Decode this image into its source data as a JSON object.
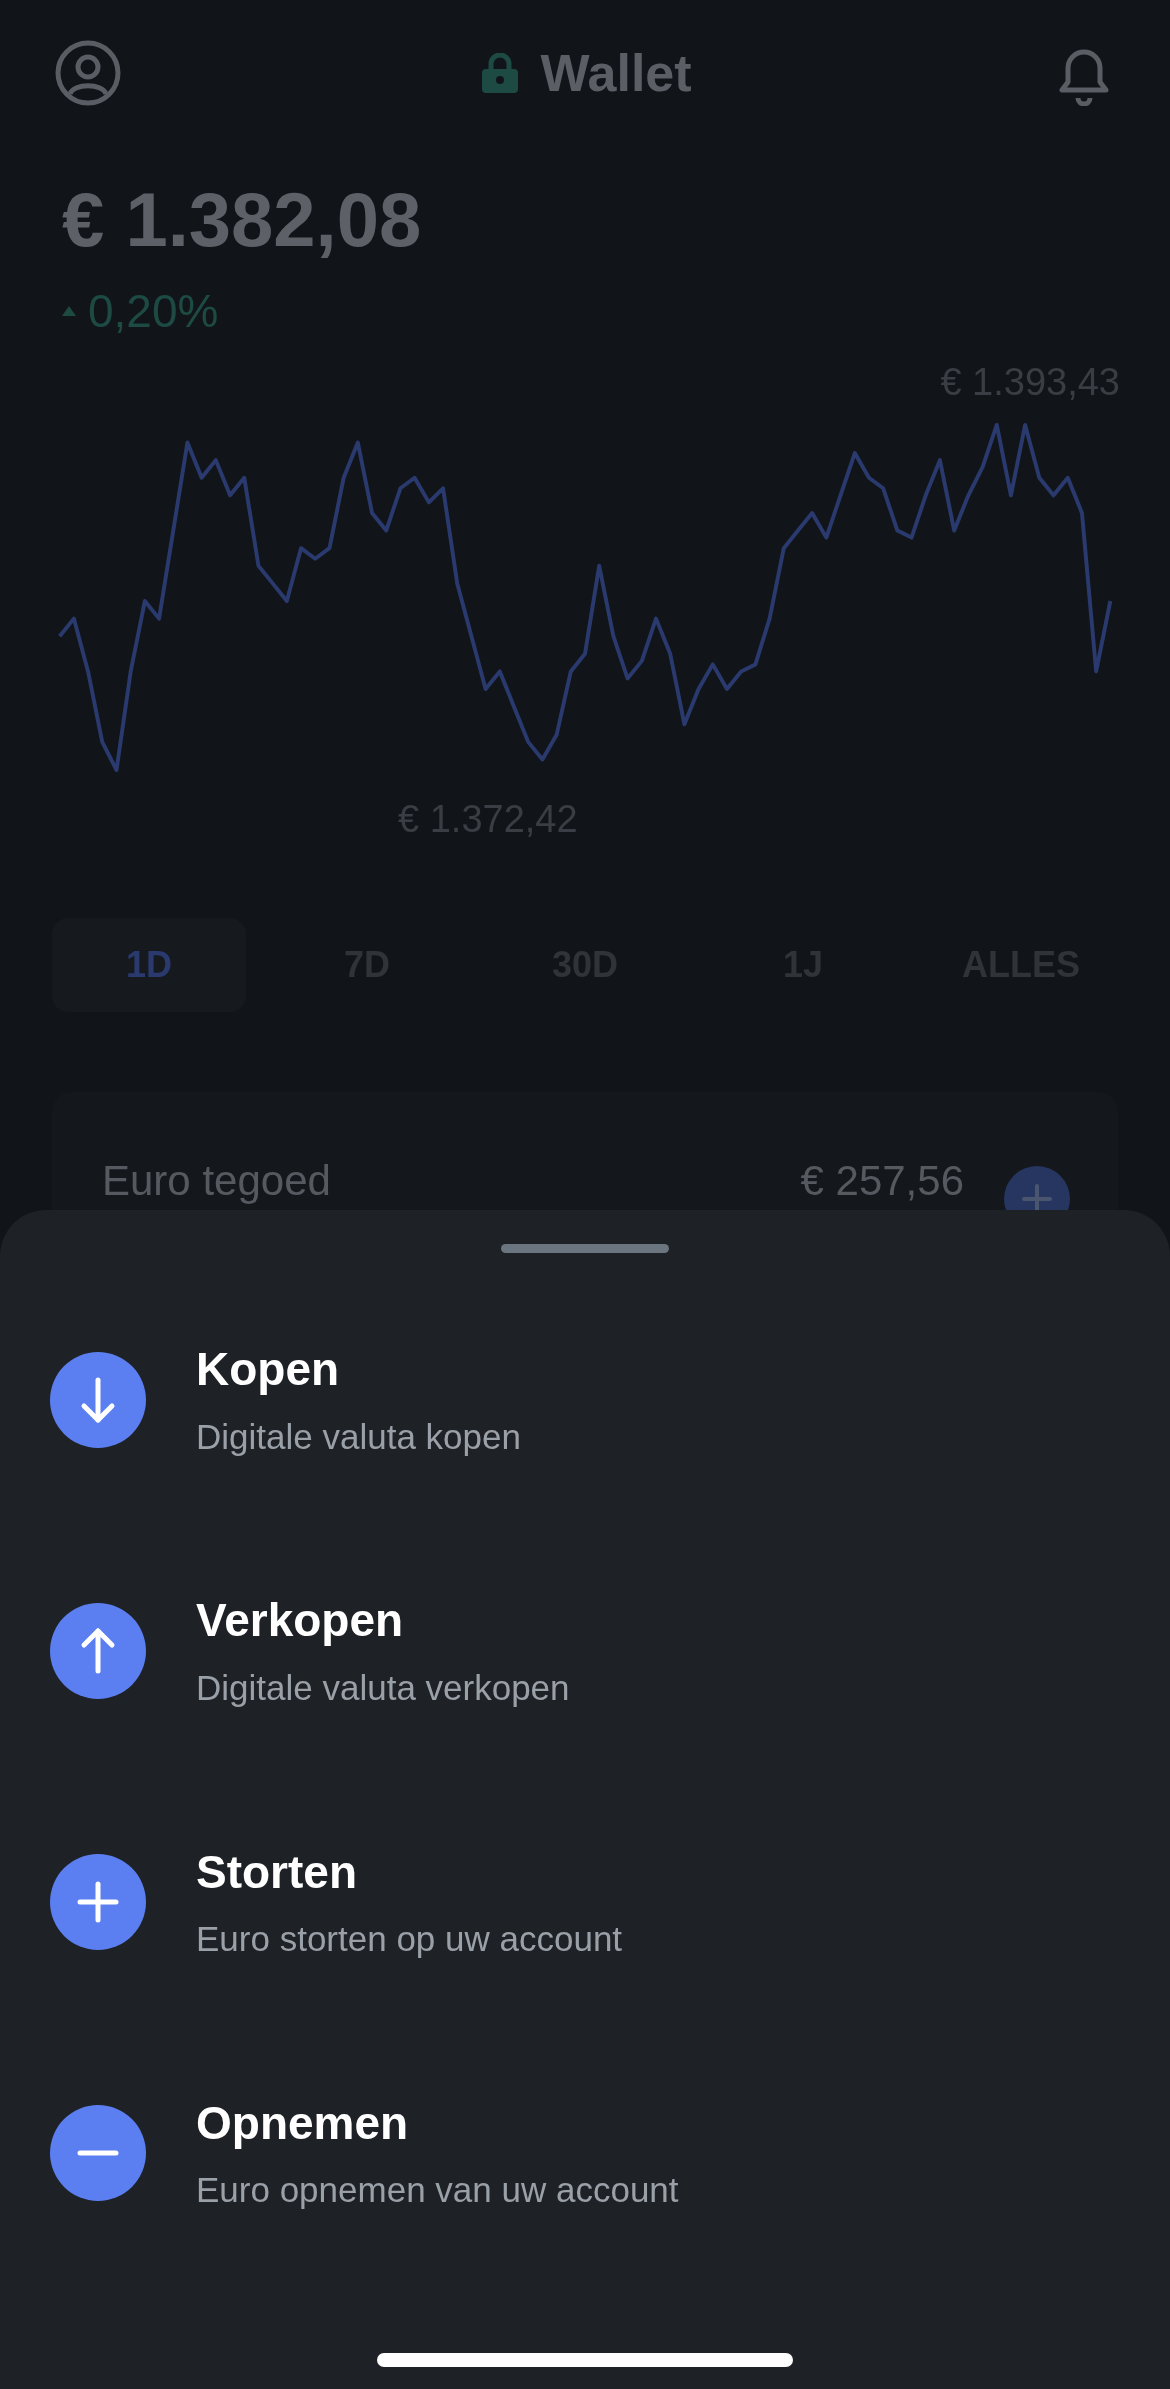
{
  "header": {
    "title": "Wallet"
  },
  "balance": {
    "amount": "€ 1.382,08",
    "change": "0,20%",
    "rising": true
  },
  "chart": {
    "max_label": "€ 1.393,43",
    "min_label": "€ 1.372,42"
  },
  "ranges": [
    {
      "label": "1D",
      "selected": true
    },
    {
      "label": "7D",
      "selected": false
    },
    {
      "label": "30D",
      "selected": false
    },
    {
      "label": "1J",
      "selected": false
    },
    {
      "label": "ALLES",
      "selected": false
    }
  ],
  "balance_card": {
    "label": "Euro tegoed",
    "amount": "€ 257,56"
  },
  "sheet": {
    "actions": [
      {
        "kind": "buy",
        "title": "Kopen",
        "subtitle": "Digitale valuta kopen"
      },
      {
        "kind": "sell",
        "title": "Verkopen",
        "subtitle": "Digitale valuta verkopen"
      },
      {
        "kind": "deposit",
        "title": "Storten",
        "subtitle": "Euro storten op uw account"
      },
      {
        "kind": "withdraw",
        "title": "Opnemen",
        "subtitle": "Euro opnemen van uw account"
      }
    ]
  }
}
